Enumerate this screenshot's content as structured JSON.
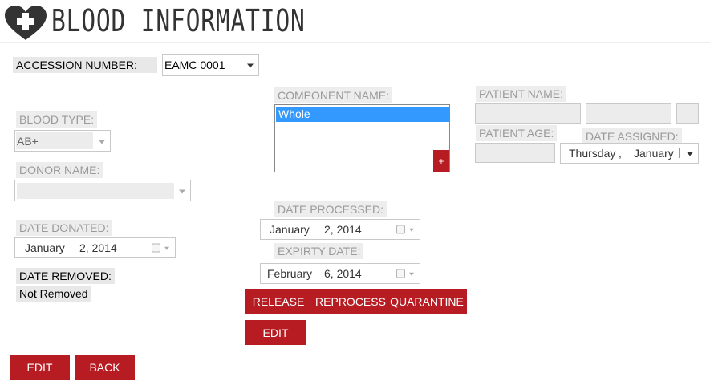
{
  "header": {
    "title": "BLOOD INFORMATION",
    "icon": "heart-plus-icon"
  },
  "accession": {
    "label": "ACCESSION NUMBER:",
    "value": "EAMC 0001"
  },
  "blood_type": {
    "label": "BLOOD TYPE:",
    "value": "AB+"
  },
  "donor_name": {
    "label": "DONOR NAME:",
    "value": ""
  },
  "date_donated": {
    "label": "DATE DONATED:",
    "month": "January",
    "day_year": "2, 2014"
  },
  "date_removed": {
    "label": "DATE REMOVED:",
    "value": "Not Removed"
  },
  "component": {
    "label": "COMPONENT NAME:",
    "selected": "Whole",
    "add_label": "+"
  },
  "date_processed": {
    "label": "DATE PROCESSED:",
    "month": "January",
    "day_year": "2, 2014"
  },
  "expiry_date": {
    "label": "EXPIRTY DATE:",
    "month": "February",
    "day_year": "6, 2014"
  },
  "actions": {
    "release": "RELEASE",
    "reprocess": "REPROCESS",
    "quarantine": "QUARANTINE",
    "edit": "EDIT"
  },
  "patient": {
    "name_label": "PATIENT NAME:",
    "age_label": "PATIENT AGE:",
    "date_assigned_label": "DATE ASSIGNED:",
    "date_assigned_weekday": "Thursday",
    "date_assigned_sep": ",",
    "date_assigned_month": "January"
  },
  "footer": {
    "edit": "EDIT",
    "back": "BACK"
  },
  "colors": {
    "accent": "#b71c22",
    "selection": "#3399ff"
  }
}
